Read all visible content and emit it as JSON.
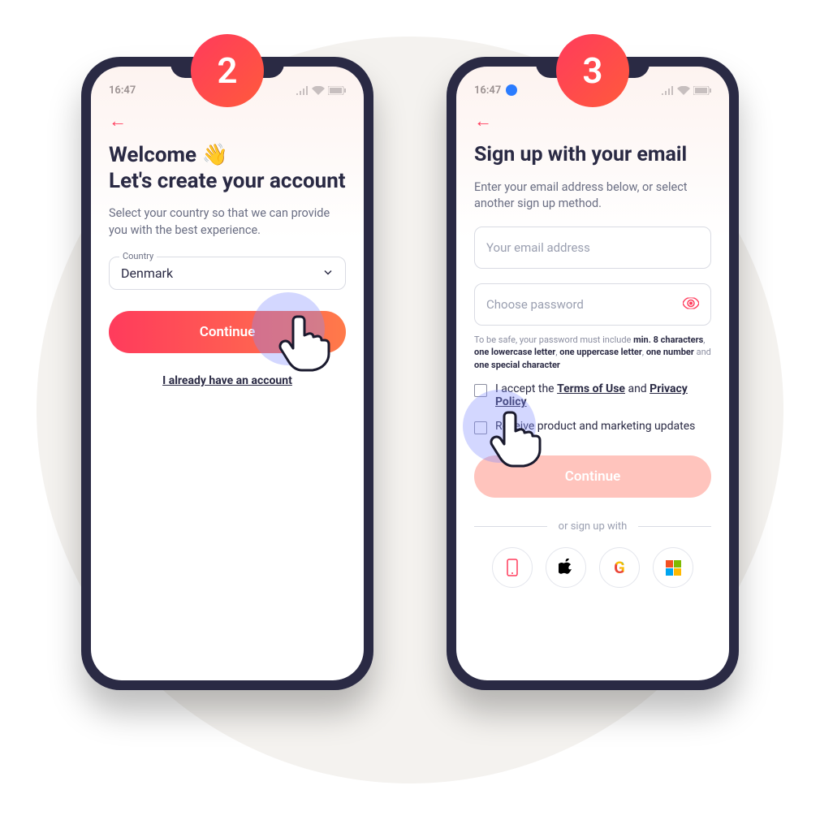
{
  "steps": {
    "left": "2",
    "right": "3"
  },
  "status": {
    "time": "16:47"
  },
  "left": {
    "title_line1": "Welcome 👋",
    "title_line2": "Let's create your account",
    "subtitle": "Select your country so that we can provide you with the best experience.",
    "country_label": "Country",
    "country_value": "Denmark",
    "continue": "Continue",
    "have_account": "I already have an account"
  },
  "right": {
    "title": "Sign up with your email",
    "subtitle": "Enter your email address below, or select another sign up method.",
    "email_placeholder": "Your email address",
    "password_placeholder": "Choose password",
    "pw_hint_prefix": "To be safe, your password must include ",
    "pw_hint_b1": "min. 8 characters",
    "pw_hint_s1": ", ",
    "pw_hint_b2": "one lowercase letter",
    "pw_hint_s2": ", ",
    "pw_hint_b3": "one uppercase letter",
    "pw_hint_s3": ", ",
    "pw_hint_b4": "one number",
    "pw_hint_s4": " and ",
    "pw_hint_b5": "one special character",
    "terms_prefix": "I accept the ",
    "terms_link": "Terms of Use",
    "terms_mid": " and ",
    "privacy_link": "Privacy Policy",
    "marketing": "Receive product and marketing updates",
    "continue": "Continue",
    "or_signup": "or sign up with"
  },
  "socials": {
    "phone": "phone-icon",
    "apple": "apple-icon",
    "google": "google-icon",
    "microsoft": "microsoft-icon"
  }
}
